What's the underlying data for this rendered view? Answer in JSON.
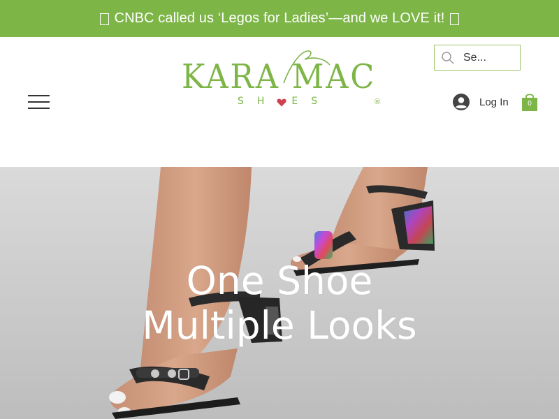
{
  "announcement": {
    "text": "CNBC called us ‘Legos for Ladies’—and we LOVE it!"
  },
  "logo": {
    "wordmark": "KARA MAC",
    "subline_left": "SH",
    "subline_right": "ES",
    "registered": "®"
  },
  "search": {
    "placeholder": "Se..."
  },
  "account": {
    "login_label": "Log In"
  },
  "cart": {
    "count": "0"
  },
  "hero": {
    "title_line1": "One Shoe",
    "title_line2": "Multiple Looks"
  },
  "colors": {
    "brand_green": "#7db547",
    "text_dark": "#333333",
    "hero_bg": "#cfcfd0"
  },
  "icons": [
    "hamburger-menu-icon",
    "search-icon",
    "user-avatar-icon",
    "shopping-bag-icon",
    "heart-icon"
  ]
}
